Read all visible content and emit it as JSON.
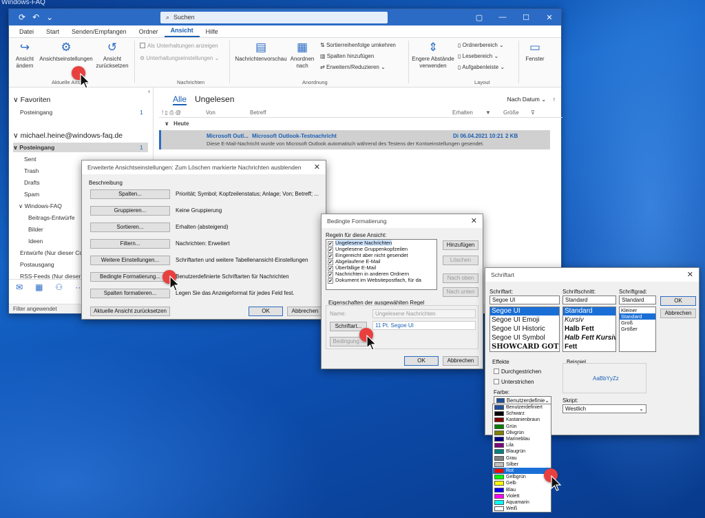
{
  "desktop": {
    "watermark": "Windows-FAQ"
  },
  "outlook": {
    "search_placeholder": "Suchen",
    "menu": [
      "Datei",
      "Start",
      "Senden/Empfangen",
      "Ordner",
      "Ansicht",
      "Hilfe"
    ],
    "active_menu": "Ansicht",
    "ribbon": {
      "ansicht_aendern": "Ansicht ändern",
      "ansichtseinstellungen": "Ansichtseinstellungen",
      "ansicht_zuruecksetzen": "Ansicht zurücksetzen",
      "group_aktuelle": "Aktuelle Ansicht",
      "als_unterhaltungen": "Als Unterhaltungen anzeigen",
      "unterhaltungseinstellungen": "Unterhaltungseinstellungen",
      "group_nachrichten": "Nachrichten",
      "nachrichtenvorschau": "Nachrichtenvorschau",
      "anordnen_nach": "Anordnen nach",
      "sortierreihenfolge": "Sortierreihenfolge umkehren",
      "spalten_hinzufuegen": "Spalten hinzufügen",
      "erweitern_reduzieren": "Erweitern/Reduzieren",
      "group_anordnung": "Anordnung",
      "engere_abstaende": "Engere Abstände verwenden",
      "ordnerbereich": "Ordnerbereich",
      "lesebereich": "Lesebereich",
      "aufgabenleiste": "Aufgabenleiste",
      "group_layout": "Layout",
      "fenster": "Fenster"
    },
    "nav": {
      "favoriten": "Favoriten",
      "posteingang_fav": "Posteingang",
      "posteingang_fav_count": "1",
      "account": "michael.heine@windows-faq.de",
      "posteingang": "Posteingang",
      "posteingang_count": "1",
      "folders": [
        "Sent",
        "Trash",
        "Drafts",
        "Spam"
      ],
      "windows_faq": "Windows-FAQ",
      "subfolders": [
        "Beitrags-Entwürfe",
        "Bilder",
        "Ideen"
      ],
      "entwuerfe": "Entwürfe (Nur dieser Co",
      "postausgang": "Postausgang",
      "rss": "RSS-Feeds (Nur dieser Co"
    },
    "status": "Filter angewendet",
    "list": {
      "tab_alle": "Alle",
      "tab_ungelesen": "Ungelesen",
      "sort": "Nach Datum",
      "col_von": "Von",
      "col_betreff": "Betreff",
      "col_erhalten": "Erhalten",
      "col_groesse": "Größe",
      "group": "Heute",
      "message": {
        "from": "Microsoft Outl...",
        "subject": "Microsoft Outlook-Testnachricht",
        "date": "Di 06.04.2021 10:21",
        "size": "2 KB",
        "preview": "Diese E-Mail-Nachricht wurde von Microsoft Outlook automatisch während des Testens der Kontoeinstellungen gesendet."
      }
    }
  },
  "advanced_dialog": {
    "title": "Erweiterte Ansichtseinstellungen: Zum Löschen markierte Nachrichten ausblenden",
    "section": "Beschreibung",
    "rows": [
      {
        "button": "Spalten...",
        "desc": "Priorität; Symbol; Kopfzeilenstatus; Anlage; Von; Betreff; ..."
      },
      {
        "button": "Gruppieren...",
        "desc": "Keine Gruppierung"
      },
      {
        "button": "Sortieren...",
        "desc": "Erhalten (absteigend)"
      },
      {
        "button": "Filtern...",
        "desc": "Nachrichten: Erweitert"
      },
      {
        "button": "Weitere Einstellungen...",
        "desc": "Schriftarten und weitere Tabellenansicht-Einstellungen"
      },
      {
        "button": "Bedingte Formatierung...",
        "desc": "Benutzerdefinierte Schriftarten für Nachrichten"
      },
      {
        "button": "Spalten formatieren...",
        "desc": "Legen Sie das Anzeigeformat für jedes Feld fest."
      }
    ],
    "reset": "Aktuelle Ansicht zurücksetzen",
    "ok": "OK",
    "cancel": "Abbrechen"
  },
  "cond_dialog": {
    "title": "Bedingte Formatierung",
    "rules_label": "Regeln für diese Ansicht:",
    "rules": [
      "Ungelesene Nachrichten",
      "Ungelesene Gruppenkopfzeilen",
      "Eingereicht aber nicht gesendet",
      "Abgelaufene E-Mail",
      "Überfällige E-Mail",
      "Nachrichten in anderen Ordnern",
      "Dokument im Websitepostfach, für da"
    ],
    "add": "Hinzufügen",
    "delete": "Löschen",
    "up": "Nach oben",
    "down": "Nach unten",
    "props_label": "Eigenschaften der ausgewählten Regel",
    "name_label": "Name:",
    "name_value": "Ungelesene Nachrichten",
    "font_button": "Schriftart...",
    "font_value": "11 Pt. Segoe UI",
    "condition_button": "Bedingung...",
    "ok": "OK",
    "cancel": "Abbrechen"
  },
  "font_dialog": {
    "title": "Schriftart",
    "font_label": "Schriftart:",
    "font_value": "Segoe UI",
    "fonts": [
      "Segoe UI",
      "Segoe UI Emoji",
      "Segoe UI Historic",
      "Segoe UI Symbol",
      "SHOWCARD GOTHIC"
    ],
    "style_label": "Schriftschnitt:",
    "style_value": "Standard",
    "styles": [
      "Standard",
      "Kursiv",
      "Halb Fett",
      "Halb Fett Kursiv",
      "Fett"
    ],
    "size_label": "Schriftgrad:",
    "size_value": "Standard",
    "sizes": [
      "Kleiner",
      "Standard",
      "Groß",
      "Größer"
    ],
    "ok": "OK",
    "cancel": "Abbrechen",
    "effects_label": "Effekte",
    "strike": "Durchgestrichen",
    "underline": "Unterstrichen",
    "color_label": "Farbe:",
    "color_value": "Benutzerdefinie",
    "sample_label": "Beispiel",
    "sample_text": "AaBbYyZz",
    "script_label": "Skript:",
    "script_value": "Westlich",
    "colors": [
      {
        "name": "Benutzerdefiniert",
        "hex": "#1f4e9c"
      },
      {
        "name": "Schwarz",
        "hex": "#000000"
      },
      {
        "name": "Kastanienbraun",
        "hex": "#800000"
      },
      {
        "name": "Grün",
        "hex": "#008000"
      },
      {
        "name": "Olivgrün",
        "hex": "#808000"
      },
      {
        "name": "Marineblau",
        "hex": "#000080"
      },
      {
        "name": "Lila",
        "hex": "#800080"
      },
      {
        "name": "Blaugrün",
        "hex": "#008080"
      },
      {
        "name": "Grau",
        "hex": "#808080"
      },
      {
        "name": "Silber",
        "hex": "#c0c0c0"
      },
      {
        "name": "Rot",
        "hex": "#ff0000"
      },
      {
        "name": "Gelbgrün",
        "hex": "#00ff00"
      },
      {
        "name": "Gelb",
        "hex": "#ffff00"
      },
      {
        "name": "Blau",
        "hex": "#0000ff"
      },
      {
        "name": "Violett",
        "hex": "#ff00ff"
      },
      {
        "name": "Aquamarin",
        "hex": "#00ffff"
      },
      {
        "name": "Weiß",
        "hex": "#ffffff"
      }
    ],
    "selected_color": "Rot"
  }
}
